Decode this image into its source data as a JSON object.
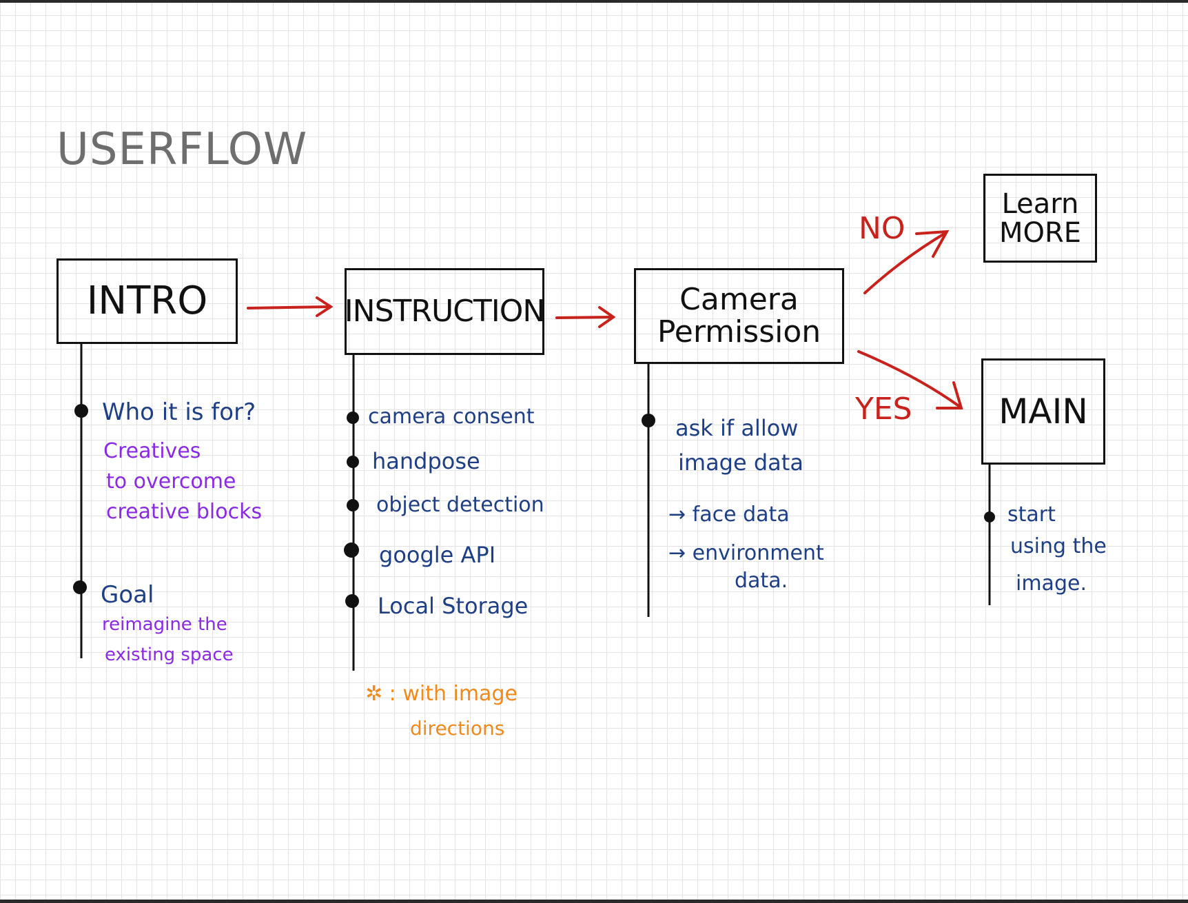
{
  "title": "USERFLOW",
  "boxes": {
    "intro": {
      "line1": "INTRO"
    },
    "instruction": {
      "line1": "INSTRUCTION"
    },
    "camera": {
      "line1": "Camera",
      "line2": "Permission"
    },
    "learn_more": {
      "line1": "Learn",
      "line2": "MORE"
    },
    "main": {
      "line1": "MAIN"
    }
  },
  "edge_labels": {
    "no": "NO",
    "yes": "YES"
  },
  "intro_notes": {
    "who_heading": "Who it is for?",
    "who_lines": [
      "Creatives",
      "to overcome",
      "creative blocks"
    ],
    "goal_heading": "Goal",
    "goal_lines": [
      "reimagine the",
      "existing space"
    ]
  },
  "instruction_notes": {
    "items": [
      "camera consent",
      "handpose",
      "object detection",
      "google API",
      "Local Storage"
    ],
    "footnote_line1": "✲ : with image",
    "footnote_line2": "directions"
  },
  "camera_notes": {
    "lines": [
      "ask if allow",
      "image data"
    ],
    "sub1": "→  face data",
    "sub2_line1": "→  environment",
    "sub2_line2": "data."
  },
  "main_notes": {
    "lines": [
      "start",
      "using the",
      "image."
    ]
  },
  "colors": {
    "arrow": "#c8221c",
    "note_blue": "#1f3f85",
    "note_purple": "#8a2be2",
    "note_orange": "#f08a1c",
    "title_gray": "#6e6e6e"
  }
}
